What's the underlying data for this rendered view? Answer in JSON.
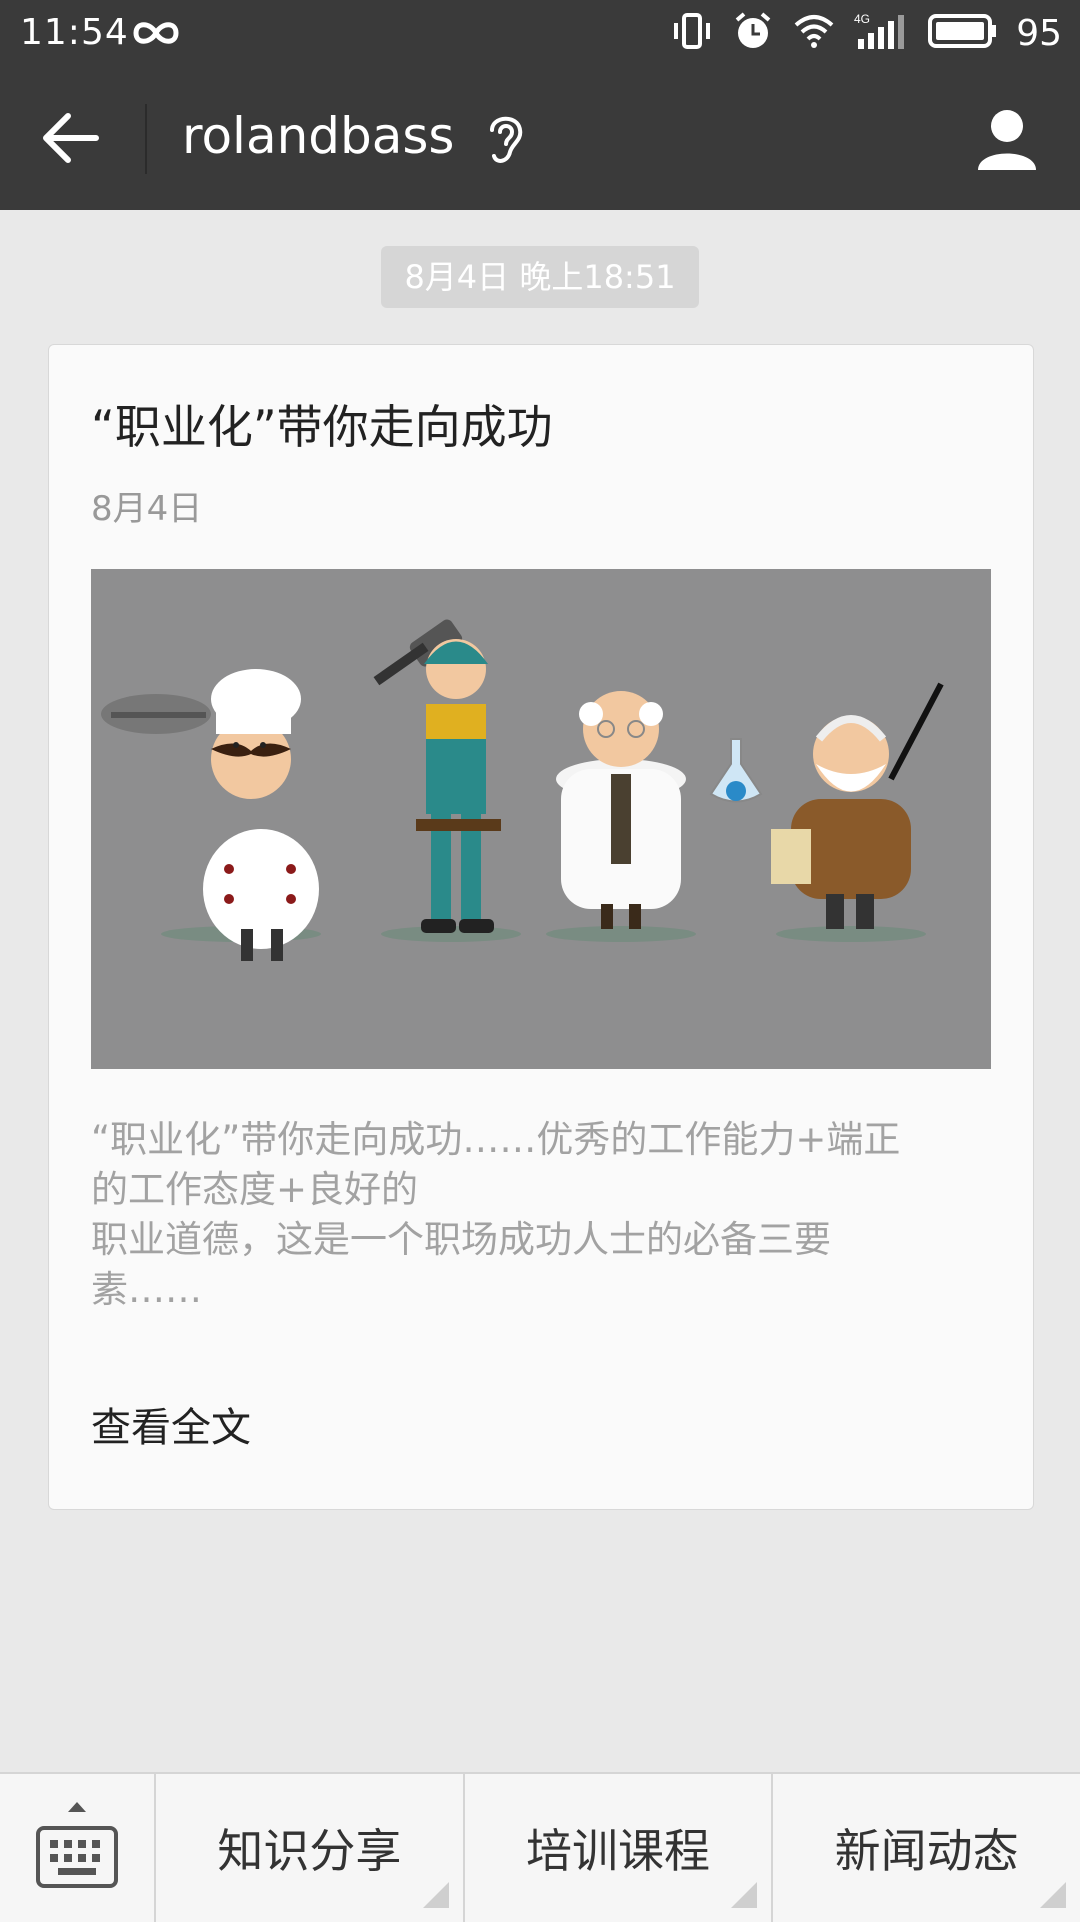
{
  "status": {
    "time": "11:54",
    "battery": "95",
    "network": "4G"
  },
  "header": {
    "title": "rolandbass"
  },
  "chat": {
    "timestamp": "8月4日 晚上18:51"
  },
  "article": {
    "title": "“职业化”带你走向成功",
    "date": "8月4日",
    "summary_lines": [
      "“职业化”带你走向成功……优秀的工作能力+端正",
      "的工作态度+良好的",
      "职业道德，这是一个职场成功人士的必备三要",
      "素……"
    ],
    "read_more": "查看全文"
  },
  "menu": {
    "items": [
      "知识分享",
      "培训课程",
      "新闻动态"
    ]
  },
  "colors": {
    "bar": "#3a3a3a",
    "background": "#e9e9e9",
    "card": "#fafafa"
  }
}
